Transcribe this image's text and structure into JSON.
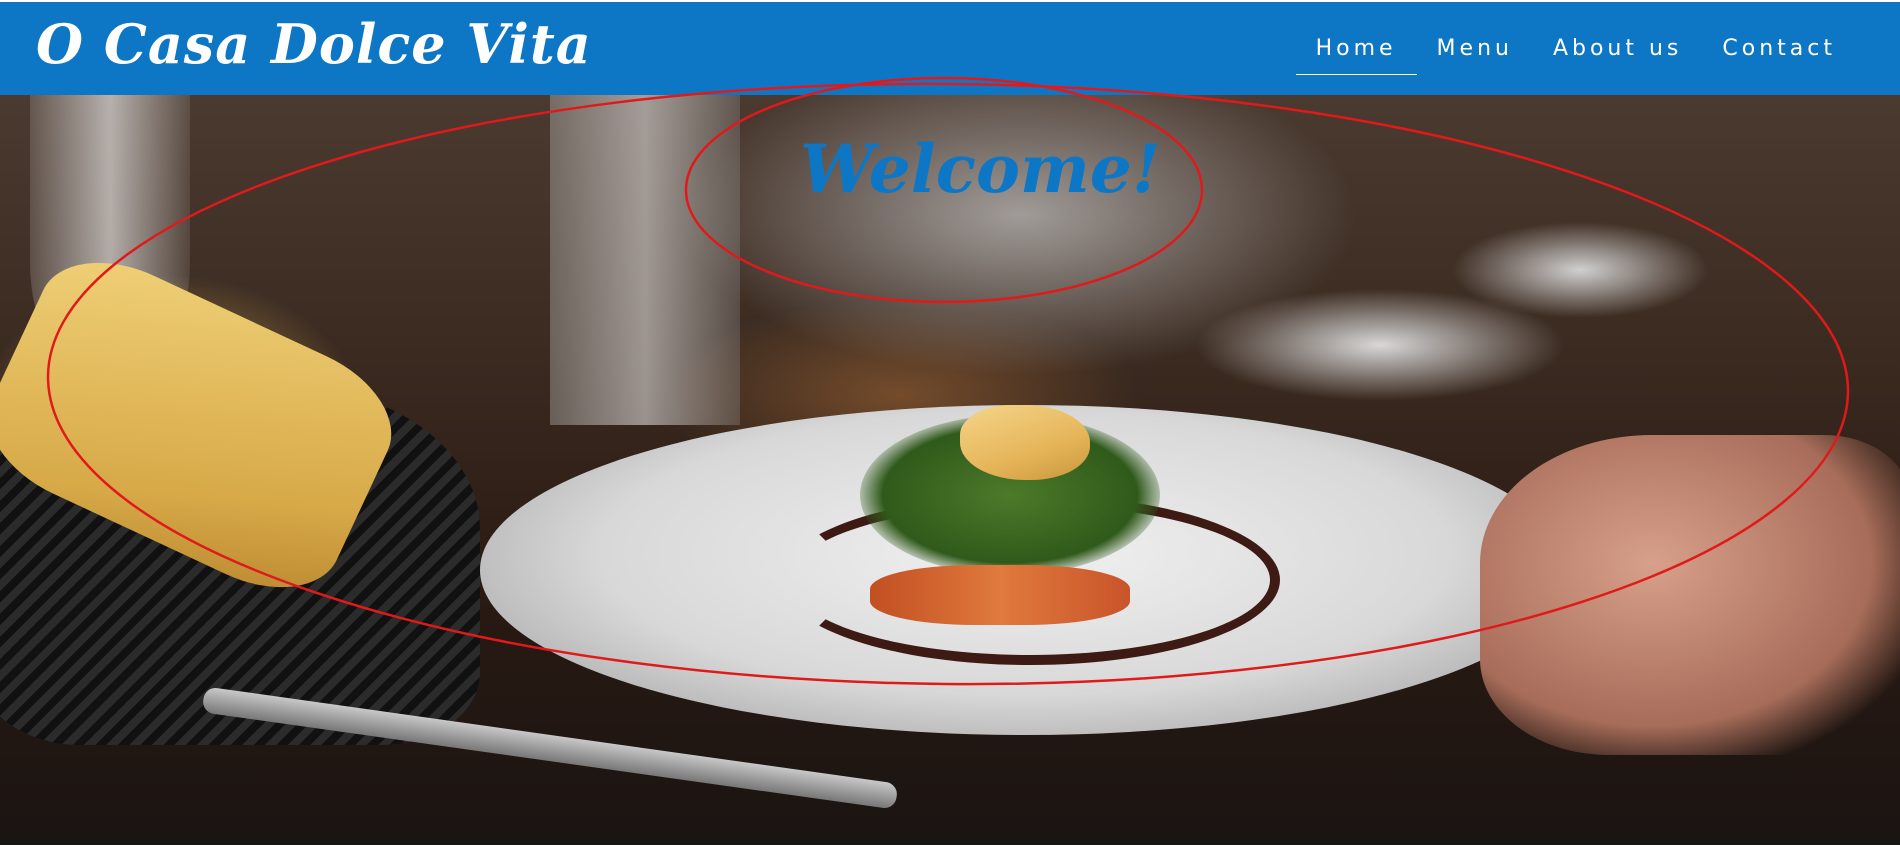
{
  "header": {
    "logo_text": "O Casa Dolce Vita",
    "background_color": "#0e77c5",
    "nav": [
      {
        "label": "Home",
        "active": true
      },
      {
        "label": "Menu",
        "active": false
      },
      {
        "label": "About us",
        "active": false
      },
      {
        "label": "Contact",
        "active": false
      }
    ]
  },
  "hero": {
    "heading": "Welcome!",
    "heading_color": "#0e77c5",
    "image_subject": "restaurant-plated-dish-photo",
    "annotation_color": "#e01a1a"
  }
}
